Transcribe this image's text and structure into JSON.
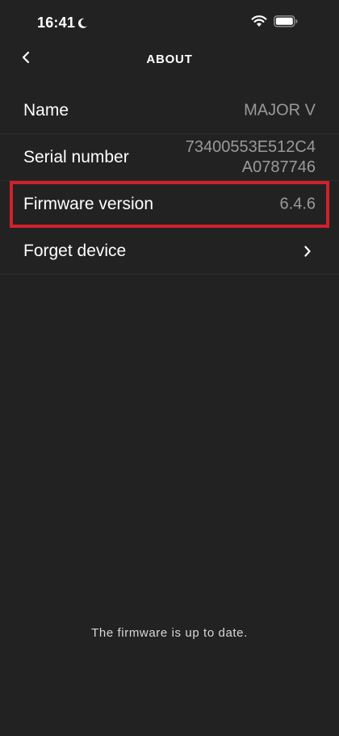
{
  "status_bar": {
    "time": "16:41",
    "icons": [
      "moon-icon",
      "wifi-icon",
      "battery-icon"
    ]
  },
  "nav": {
    "title": "ABOUT",
    "back_icon": "chevron-left-icon"
  },
  "rows": [
    {
      "label": "Name",
      "value": "MAJOR V"
    },
    {
      "label": "Serial number",
      "value_lines": [
        "73400553E512C4",
        "A0787746"
      ]
    },
    {
      "label": "Firmware version",
      "value": "6.4.6",
      "highlighted": true
    },
    {
      "label": "Forget device",
      "icon": "chevron-right-icon"
    }
  ],
  "footer": {
    "message": "The firmware is up to date."
  },
  "colors": {
    "background": "#222222",
    "highlight": "#d0212b",
    "value_text": "#9a9a9a"
  }
}
